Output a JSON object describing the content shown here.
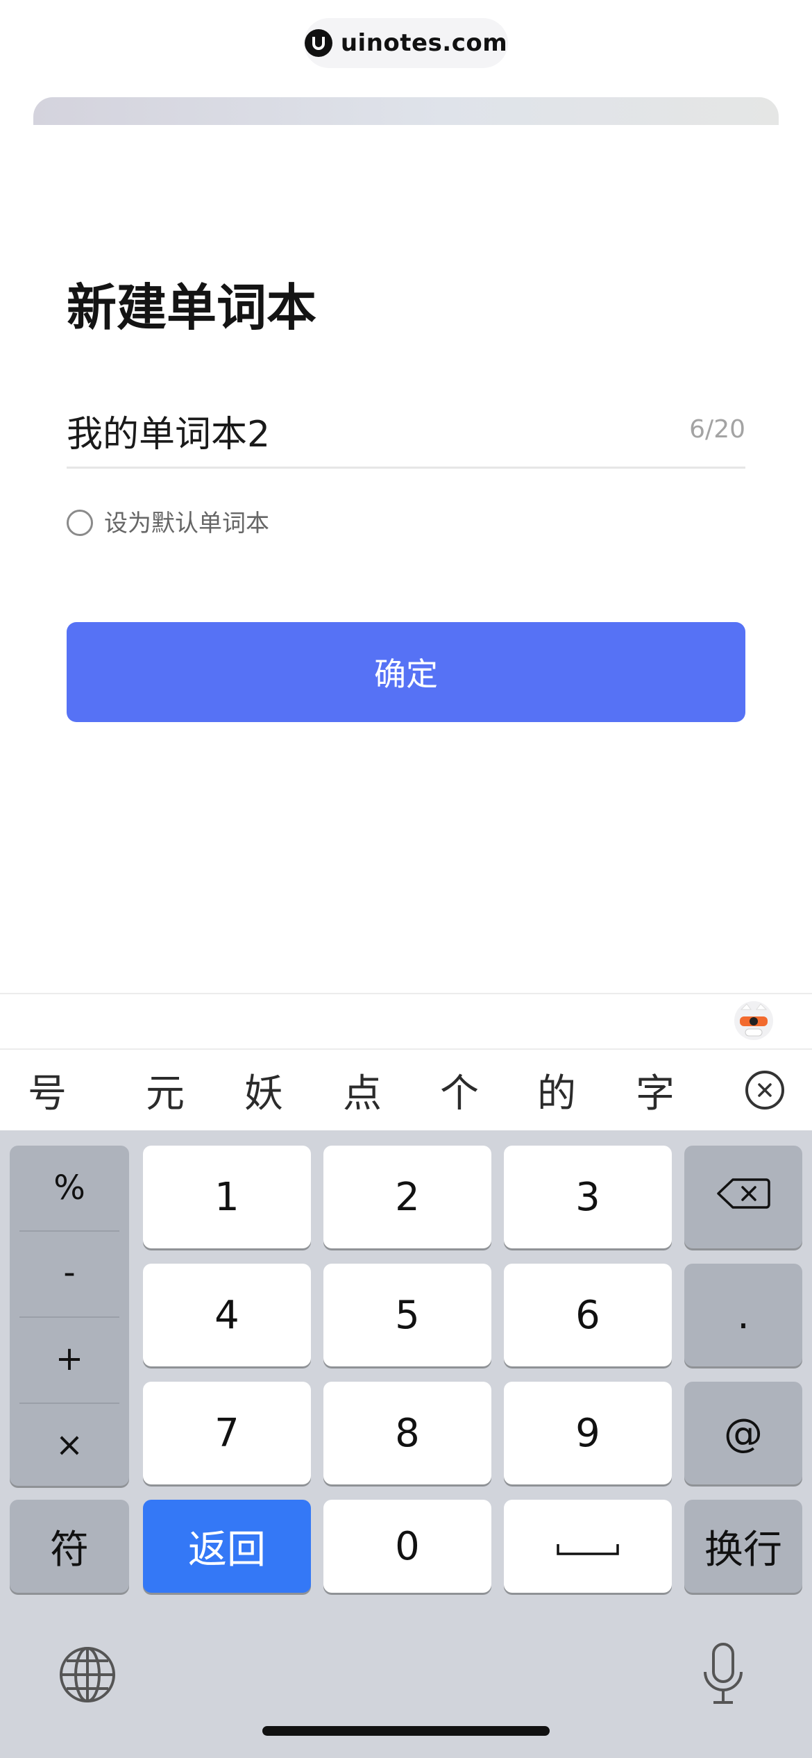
{
  "watermark": {
    "text": "uinotes.com"
  },
  "page": {
    "title": "新建单词本",
    "name_input": {
      "value": "我的单词本2",
      "placeholder": ""
    },
    "char_count": "6/20",
    "default_option_label": "设为默认单词本",
    "default_option_checked": false,
    "confirm_label": "确定"
  },
  "keyboard": {
    "candidates": [
      "号",
      "元",
      "妖",
      "点",
      "个",
      "的",
      "字"
    ],
    "symbol_keys": [
      "%",
      "-",
      "+",
      "×"
    ],
    "digits_row1": [
      "1",
      "2",
      "3"
    ],
    "digits_row2": [
      "4",
      "5",
      "6"
    ],
    "digits_row3": [
      "7",
      "8",
      "9"
    ],
    "dot_key": ".",
    "at_key": "@",
    "symbols_key": "符",
    "return_key": "返回",
    "zero_key": "0",
    "newline_key": "换行",
    "icons": [
      "mascot-icon",
      "close-candidates-icon",
      "backspace-icon",
      "space-icon",
      "globe-icon",
      "microphone-icon"
    ]
  },
  "colors": {
    "accent": "#5672f5",
    "return_key": "#3478f6",
    "keyboard_bg": "#d1d4db",
    "function_key": "#aeb3bc"
  }
}
